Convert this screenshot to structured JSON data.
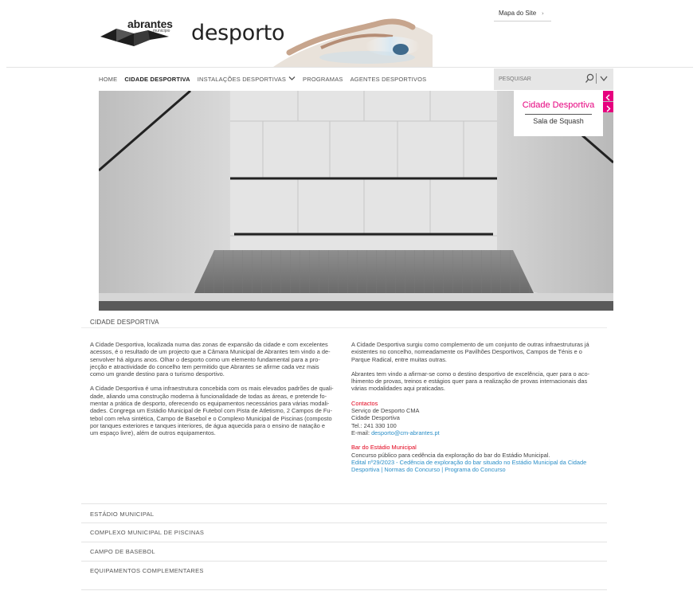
{
  "brand": {
    "logo_name": "abrantes",
    "logo_sub": "município",
    "site_title": "desporto"
  },
  "header": {
    "sitemap_label": "Mapa do Site",
    "sitemap_chevron": "›"
  },
  "nav": {
    "items": [
      {
        "label": "HOME",
        "active": false
      },
      {
        "label": "CIDADE DESPORTIVA",
        "active": true
      },
      {
        "label": "INSTALAÇÕES DESPORTIVAS",
        "active": false,
        "has_dropdown": true
      },
      {
        "label": "PROGRAMAS",
        "active": false
      },
      {
        "label": "AGENTES DESPORTIVOS",
        "active": false
      }
    ],
    "search_placeholder": "PESQUISAR"
  },
  "hero": {
    "caption_title": "Cidade Desportiva",
    "caption_sub": "Sala de Squash",
    "prev_glyph": "‹",
    "next_glyph": "›"
  },
  "section": {
    "title": "CIDADE DESPORTIVA",
    "left": {
      "p1_lines": [
        "A Cidade Desportiva, localizada numa das zonas de expansão da cidade e com excelentes",
        "acessos, é o resultado de um projecto que a Câmara Municipal de Abrantes tem vindo a de-",
        "senvolver há alguns anos. Olhar o desporto como um elemento fundamental para a pro-",
        "jecção e atractividade do concelho tem permitido que Abrantes se afirme cada vez mais",
        "como um grande destino para o turismo desportivo."
      ],
      "p2_lines": [
        "A Cidade Desportiva é uma infraestrutura concebida com os mais elevados padrões de quali-",
        "dade, aliando uma construção moderna à funcionalidade de todas as áreas, e pretende fo-",
        "mentar a prática de desporto, oferecendo os equipamentos necessários para várias modali-",
        "dades. Congrega um Estádio Municipal de Futebol com Pista de Atletismo, 2 Campos de Fu-",
        "tebol com relva sintética, Campo de Basebol e o Complexo Municipal de Piscinas (composto",
        "por tanques exteriores e tanques interiores, de água aquecida para o ensino de natação e",
        "um espaço livre), além de outros equipamentos."
      ]
    },
    "right": {
      "p1_lines": [
        "A Cidade Desportiva surgiu como complemento de um conjunto de outras infraestruturas já",
        "existentes no concelho, nomeadamente os Pavilhões Desportivos, Campos de Ténis e o",
        "Parque Radical, entre muitas outras."
      ],
      "p2_lines": [
        "Abrantes tem vindo a afirmar-se como o destino desportivo de excelência, quer para o aco-",
        "lhimento de provas, treinos e estágios quer para a realização de provas internacionais das",
        "várias modalidades aqui praticadas."
      ],
      "contacts": {
        "heading": "Contactos",
        "lines": [
          "Serviço de Desporto CMA",
          "Cidade Desportiva",
          "Tel.: 241 330 100"
        ],
        "email_prefix": "E-mail: ",
        "email": "desporto@cm-abrantes.pt"
      },
      "bar": {
        "heading": "Bar do Estádio Municipal",
        "line": "Concurso público para cedência da exploração do bar do Estádio Municipal.",
        "link_line1": "Edital nº29/2023 - Cedência de exploração do bar situado no Estádio Municipal da Cidade",
        "link_line2_a": "Desportiva",
        "separator": " | ",
        "link_line2_b": "Normas do Concurso",
        "link_line2_c": "Programa do Concurso"
      }
    }
  },
  "accordion": [
    "ESTÁDIO MUNICIPAL",
    "COMPLEXO MUNICIPAL DE PISCINAS",
    "CAMPO DE BASEBOL",
    "EQUIPAMENTOS COMPLEMENTARES"
  ],
  "colors": {
    "accent": "#e6007e",
    "red": "#e2001a",
    "link": "#2a8ec7"
  }
}
